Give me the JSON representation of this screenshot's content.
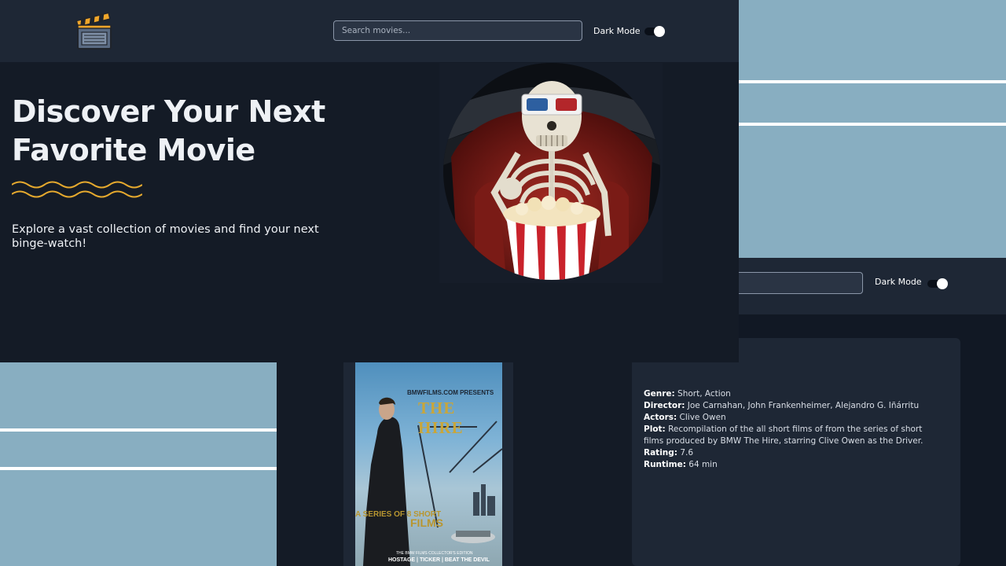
{
  "app": {
    "logo_icon": "clapperboard-icon"
  },
  "header": {
    "search_placeholder": "Search movies...",
    "dark_mode_label": "Dark Mode",
    "dark_mode_on": true
  },
  "hero": {
    "title": "Discover Your Next Favorite Movie",
    "subtitle": "Explore a vast collection of movies and find your next binge-watch!",
    "image_icon": "skeleton-popcorn-3d-glasses-illustration"
  },
  "background_header": {
    "dark_mode_label": "Dark Mode"
  },
  "movie": {
    "poster": {
      "presenter": "BMWFILMS.COM PRESENTS",
      "title": "THE HIRE",
      "series_text": "A SERIES OF 8 SHORT",
      "films_text": "FILMS",
      "edition": "THE BMW FILMS COLLECTOR'S EDITION",
      "films_list": "HOSTAGE | TICKER | BEAT THE DEVIL"
    },
    "details": [
      {
        "label": "Genre:",
        "value": "Short, Action"
      },
      {
        "label": "Director:",
        "value": "Joe Carnahan, John Frankenheimer, Alejandro G. Iñárritu"
      },
      {
        "label": "Actors:",
        "value": "Clive Owen"
      },
      {
        "label": "Plot:",
        "value": "Recompilation of the all short films of from the series of short films produced by BMW The Hire, starring Clive Owen as the Driver."
      },
      {
        "label": "Rating:",
        "value": "7.6"
      },
      {
        "label": "Runtime:",
        "value": "64 min"
      }
    ]
  },
  "colors": {
    "panel_blue": "#88aec1",
    "header_bg": "#1e2735",
    "page_bg": "#141b26",
    "accent_wave": "#e5a92e"
  }
}
